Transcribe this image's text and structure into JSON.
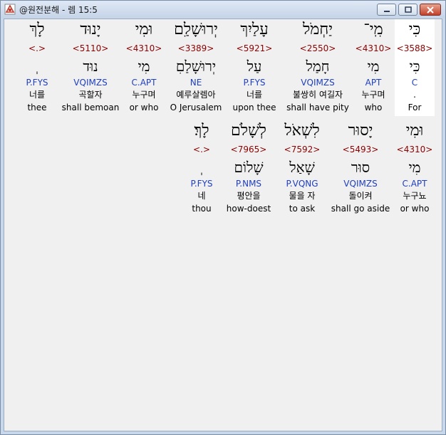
{
  "window": {
    "title": "@원전분해 - 렘 15:5",
    "controls": {
      "minimize": "minimize",
      "maximize": "maximize",
      "close": "close"
    }
  },
  "rows": [
    [
      {
        "hebrew": "כִּי",
        "strongs": "<3588>",
        "lexeme": "כִּי",
        "morph": "C",
        "korean": ".",
        "english": "For",
        "highlighted": true
      },
      {
        "hebrew": "מִֽי־",
        "strongs": "<4310>",
        "lexeme": "מִי",
        "morph": "APT",
        "korean": "누구며",
        "english": "who"
      },
      {
        "hebrew": "יַחְמֹל",
        "strongs": "<2550>",
        "lexeme": "חָמַל",
        "morph": "VQIMZS",
        "korean": "불쌍히 여길자",
        "english": "shall have pity"
      },
      {
        "hebrew": "עָלַיִךְ",
        "strongs": "<5921>",
        "lexeme": "עַל",
        "morph": "P.FYS",
        "korean": "너를",
        "english": "upon thee"
      },
      {
        "hebrew": "יְרוּשָׁלִַם",
        "strongs": "<3389>",
        "lexeme": "יְרוּשָׁלַםִ",
        "morph": "NE",
        "korean": "예루살렘아",
        "english": "O Jerusalem"
      },
      {
        "hebrew": "וּמִי",
        "strongs": "<4310>",
        "lexeme": "מִי",
        "morph": "C.APT",
        "korean": "누구며",
        "english": "or who"
      },
      {
        "hebrew": "יָנוּד",
        "strongs": "<5110>",
        "lexeme": "נוּד",
        "morph": "VQIMZS",
        "korean": "곡할자",
        "english": "shall bemoan"
      },
      {
        "hebrew": "לָךְ",
        "strongs": "<.>",
        "lexeme": "ְ",
        "morph": "P.FYS",
        "korean": "너를",
        "english": "thee"
      }
    ],
    [
      {
        "hebrew": "וּמִי",
        "strongs": "<4310>",
        "lexeme": "מִי",
        "morph": "C.APT",
        "korean": "누구뇨",
        "english": "or who"
      },
      {
        "hebrew": "יָסוּר",
        "strongs": "<5493>",
        "lexeme": "סוּר",
        "morph": "VQIMZS",
        "korean": "돌이켜",
        "english": "shall go aside"
      },
      {
        "hebrew": "לִשְׁאֹל",
        "strongs": "<7592>",
        "lexeme": "שָׁאַל",
        "morph": "P.VQNG",
        "korean": "물을 자",
        "english": "to ask"
      },
      {
        "hebrew": "לְשָׁלֹם",
        "strongs": "<7965>",
        "lexeme": "שָׁלוֹם",
        "morph": "P.NMS",
        "korean": "평안을",
        "english": "how-doest"
      },
      {
        "hebrew": "לָךְ׃",
        "strongs": "<.>",
        "lexeme": "ְ",
        "morph": "P.FYS",
        "korean": "네",
        "english": "thou"
      }
    ]
  ]
}
